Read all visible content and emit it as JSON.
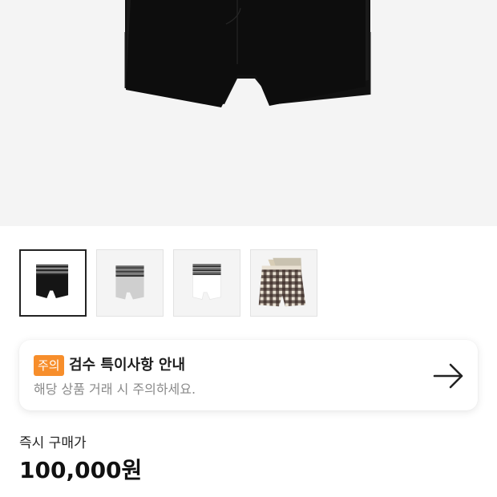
{
  "product": {
    "hero_image": "black-boxer-briefs-3pack",
    "thumbnails": [
      {
        "name": "black-boxer-briefs",
        "selected": true
      },
      {
        "name": "gray-boxer-briefs",
        "selected": false
      },
      {
        "name": "white-boxer-briefs",
        "selected": false
      },
      {
        "name": "plaid-boxer-shorts",
        "selected": false
      }
    ]
  },
  "notice": {
    "badge": "주의",
    "title": "검수 특이사항 안내",
    "description": "해당 상품 거래 시 주의하세요.",
    "icon": "arrow-right-icon",
    "badge_color": "#f78e2b"
  },
  "purchase": {
    "label": "즉시 구매가",
    "price": "100,000원"
  }
}
